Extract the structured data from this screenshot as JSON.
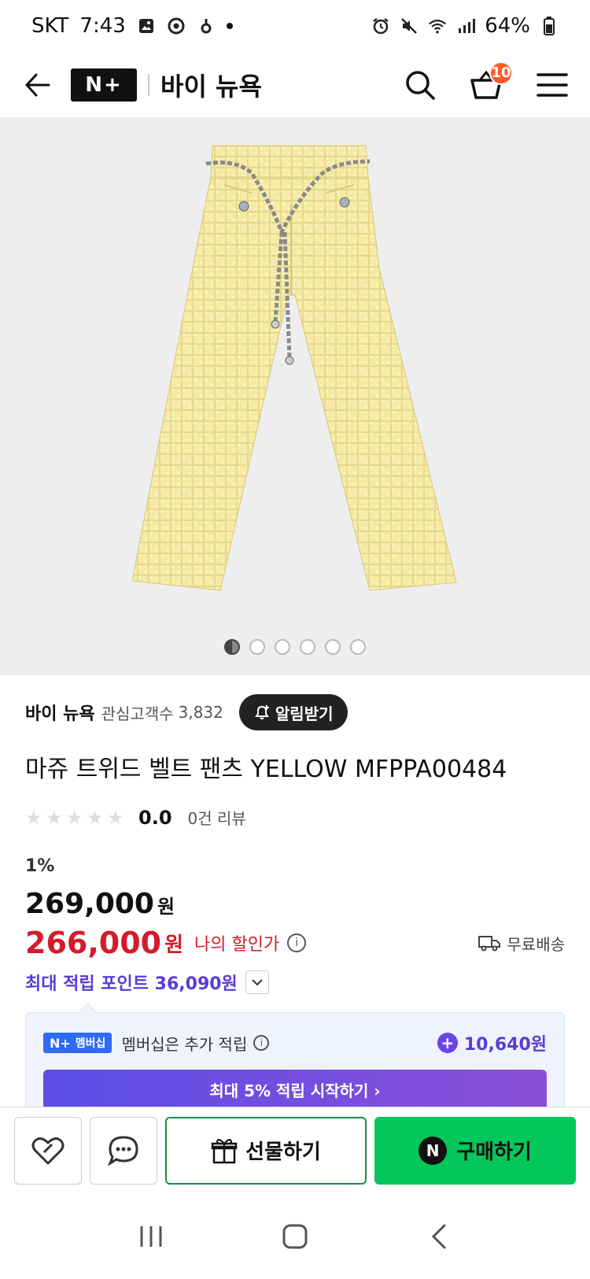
{
  "status_bar": {
    "carrier": "SKT",
    "time": "7:43",
    "battery": "64%"
  },
  "header": {
    "logo_text": "N+",
    "store_title": "바이 뉴욕",
    "cart_count": "10"
  },
  "gallery": {
    "total_images": 6,
    "active_index": 1
  },
  "store": {
    "name": "바이 뉴욕",
    "follower_label": "관심고객수",
    "follower_count": "3,832",
    "alert_button": "알림받기"
  },
  "product": {
    "title": "마쥬 트위드 벨트 팬츠 YELLOW MFPPA00484",
    "rating_score": "0.0",
    "review_count": "0건 리뷰",
    "discount_rate": "1%",
    "original_price": "269,000",
    "currency": "원",
    "sale_price": "266,000",
    "my_discount_label": "나의 할인가",
    "shipping_label": "무료배송",
    "max_points_label": "최대 적립 포인트 36,090원"
  },
  "membership": {
    "badge_logo": "N+",
    "badge_label": "멤버십",
    "text": "멤버십은 추가 적립",
    "points": "10,640원",
    "cta_label": "최대 5% 적립 시작하기 ›"
  },
  "actions": {
    "gift_label": "선물하기",
    "buy_label": "구매하기",
    "buy_icon_letter": "N"
  },
  "colors": {
    "accent_green": "#03c75a",
    "price_red": "#d31c2b",
    "points_purple": "#5a3bd7",
    "badge_orange": "#ff5a2a"
  }
}
